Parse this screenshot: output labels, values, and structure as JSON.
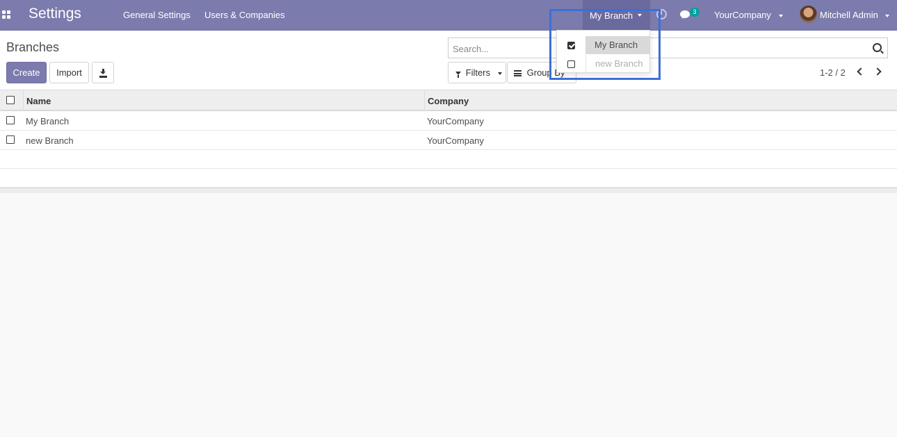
{
  "navbar": {
    "app_title": "Settings",
    "menu": [
      {
        "label": "General Settings"
      },
      {
        "label": "Users & Companies"
      }
    ],
    "branch_switcher": {
      "label": "My Branch"
    },
    "chat_badge": "3",
    "company_switcher": "YourCompany",
    "user_name": "Mitchell Admin"
  },
  "branch_dropdown": {
    "items": [
      {
        "label": "My Branch",
        "checked": true
      },
      {
        "label": "new Branch",
        "checked": false
      }
    ]
  },
  "control_panel": {
    "title": "Branches",
    "create_label": "Create",
    "import_label": "Import",
    "search_placeholder": "Search...",
    "filters_label": "Filters",
    "groupby_label": "Group By",
    "pager": "1-2 / 2"
  },
  "list": {
    "columns": [
      "Name",
      "Company"
    ],
    "rows": [
      {
        "name": "My Branch",
        "company": "YourCompany"
      },
      {
        "name": "new Branch",
        "company": "YourCompany"
      }
    ]
  },
  "colors": {
    "brand": "#7c7bad",
    "highlight": "#3b6fd9",
    "badge": "#00a09d"
  }
}
